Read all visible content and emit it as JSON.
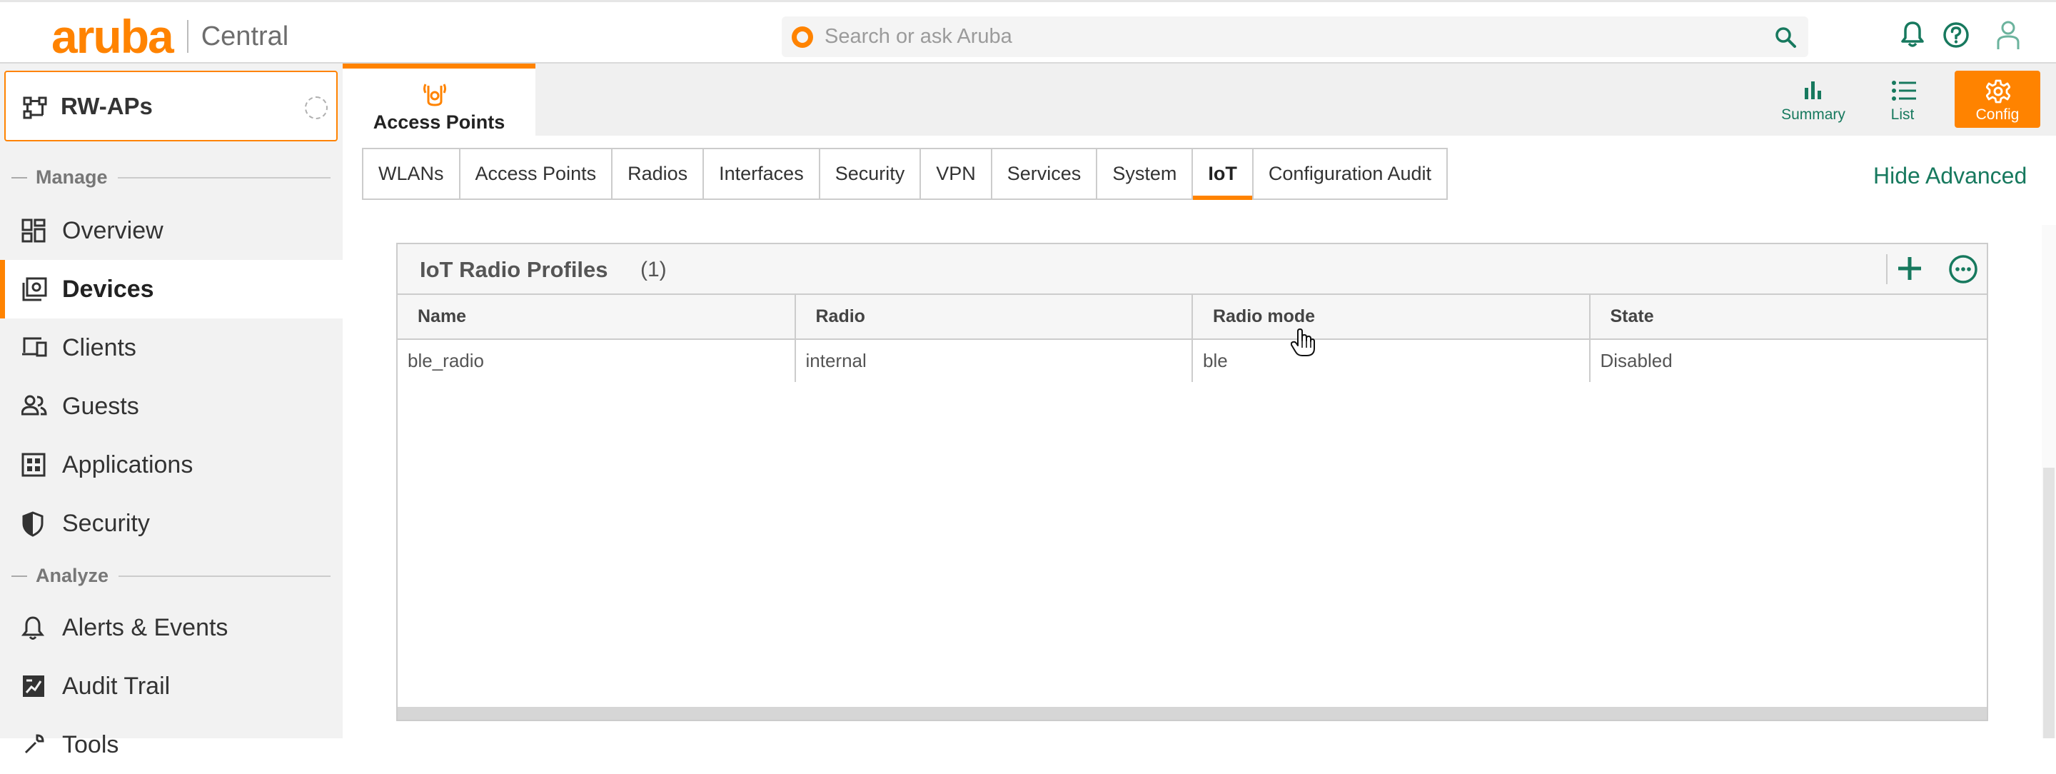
{
  "header": {
    "brand": "aruba",
    "product": "Central",
    "search_placeholder": "Search or ask Aruba"
  },
  "sidebar": {
    "group_name": "RW-APs",
    "sections": [
      {
        "title": "Manage"
      },
      {
        "title": "Analyze"
      }
    ],
    "items": [
      {
        "label": "Overview",
        "icon": "overview-icon"
      },
      {
        "label": "Devices",
        "icon": "devices-icon",
        "active": true
      },
      {
        "label": "Clients",
        "icon": "clients-icon"
      },
      {
        "label": "Guests",
        "icon": "guests-icon"
      },
      {
        "label": "Applications",
        "icon": "applications-icon"
      },
      {
        "label": "Security",
        "icon": "shield-icon"
      },
      {
        "label": "Alerts & Events",
        "icon": "bell-icon"
      },
      {
        "label": "Audit Trail",
        "icon": "audit-trail-icon"
      },
      {
        "label": "Tools",
        "icon": "tools-icon"
      }
    ]
  },
  "subheader": {
    "device_type": "Access Points",
    "views": [
      {
        "label": "Summary",
        "icon": "bar-chart-icon"
      },
      {
        "label": "List",
        "icon": "list-icon"
      },
      {
        "label": "Config",
        "icon": "gear-icon",
        "active": true
      }
    ]
  },
  "tabs": [
    "WLANs",
    "Access Points",
    "Radios",
    "Interfaces",
    "Security",
    "VPN",
    "Services",
    "System",
    "IoT",
    "Configuration Audit"
  ],
  "active_tab": "IoT",
  "hide_advanced": "Hide Advanced",
  "panel": {
    "title": "IoT Radio Profiles",
    "count": "(1)",
    "columns": [
      "Name",
      "Radio",
      "Radio mode",
      "State"
    ],
    "rows": [
      [
        "ble_radio",
        "internal",
        "ble",
        "Disabled"
      ]
    ]
  },
  "colors": {
    "accent": "#ff8300",
    "teal": "#17795e",
    "sidebar_bg": "#f2f2f2"
  }
}
